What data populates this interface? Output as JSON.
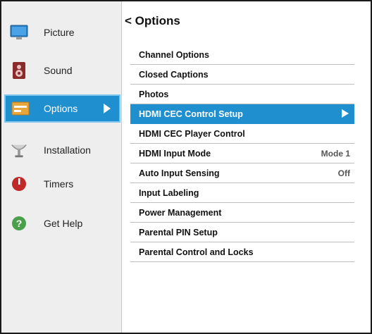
{
  "sidebar": {
    "items": [
      {
        "label": "Picture",
        "icon": "monitor-icon"
      },
      {
        "label": "Sound",
        "icon": "speaker-icon"
      },
      {
        "label": "Options",
        "icon": "options-icon",
        "selected": true
      },
      {
        "label": "Installation",
        "icon": "satellite-icon"
      },
      {
        "label": "Timers",
        "icon": "timer-icon"
      },
      {
        "label": "Get Help",
        "icon": "help-icon"
      }
    ]
  },
  "main": {
    "title": "< Options",
    "menu": [
      {
        "label": "Channel Options",
        "value": ""
      },
      {
        "label": "Closed Captions",
        "value": ""
      },
      {
        "label": "Photos",
        "value": ""
      },
      {
        "label": "HDMI CEC Control Setup",
        "value": "",
        "selected": true
      },
      {
        "label": "HDMI CEC Player Control",
        "value": ""
      },
      {
        "label": "HDMI Input Mode",
        "value": "Mode 1"
      },
      {
        "label": "Auto Input Sensing",
        "value": "Off"
      },
      {
        "label": "Input Labeling",
        "value": ""
      },
      {
        "label": "Power Management",
        "value": ""
      },
      {
        "label": "Parental PIN Setup",
        "value": ""
      },
      {
        "label": "Parental Control and Locks",
        "value": ""
      }
    ]
  },
  "colors": {
    "highlight": "#1f8fd0",
    "sidebar_bg": "#eeeeee"
  }
}
